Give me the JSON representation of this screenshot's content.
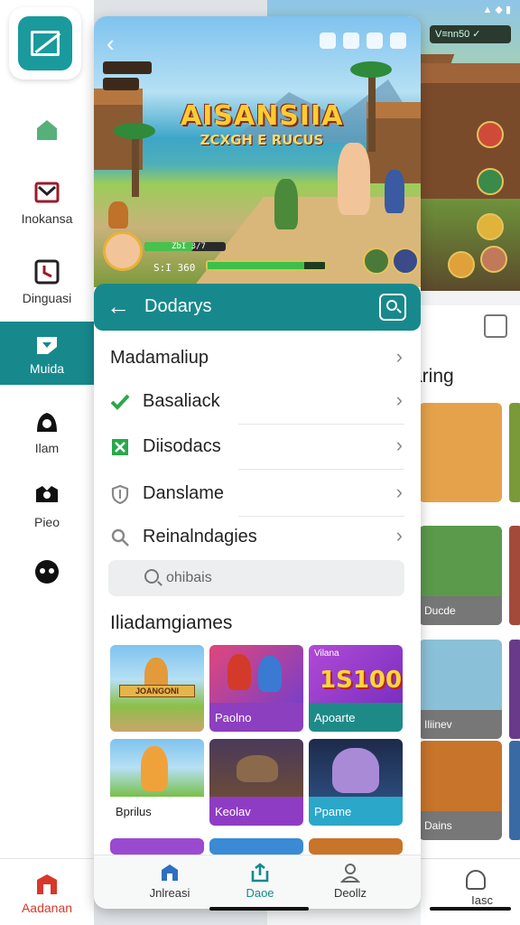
{
  "background_app": {
    "status": "▲ ◆ ▮",
    "hud_label": "V≡nn50 ✓",
    "section_title": "aring",
    "cards": [
      {
        "label": "",
        "color": "#e07b39"
      },
      {
        "label": "Ducde",
        "color": "#8c8f93"
      },
      {
        "label": "Iliinev",
        "color": "#8c8f93"
      },
      {
        "label": "Dains",
        "color": "#8c8f93"
      }
    ],
    "nav_label": "Iasc"
  },
  "sidebar": {
    "logo_icon": "presentation-logo-icon",
    "items": [
      {
        "icon": "home-icon",
        "label": ""
      },
      {
        "icon": "inbox-icon",
        "label": "Inokansa"
      },
      {
        "icon": "clock-icon",
        "label": "Dinguasi"
      },
      {
        "icon": "media-icon",
        "label": "Muida",
        "active": true
      },
      {
        "icon": "person-icon",
        "label": "Ilam"
      },
      {
        "icon": "gallery-icon",
        "label": "Pieo"
      },
      {
        "icon": "controller-icon",
        "label": ""
      }
    ],
    "bottom_label": "Aadanan",
    "accent": "#17898c"
  },
  "hero": {
    "game_title": "AISANSIIA",
    "game_subtitle": "ZCXGH E RUCUS",
    "score": "S:I 360",
    "hp_label": "ZbI 3/7"
  },
  "header": {
    "title": "Dodarys"
  },
  "menu": {
    "heading": "Madamaliup",
    "items": [
      {
        "icon": "check-icon",
        "label": "Basaliack"
      },
      {
        "icon": "close-box-icon",
        "label": "Diisodacs"
      },
      {
        "icon": "shield-icon",
        "label": "Danslame"
      },
      {
        "icon": "search-icon",
        "label": "Reinalndagies"
      }
    ]
  },
  "search": {
    "placeholder": "ohibais"
  },
  "games_section": {
    "title": "Iliadamgiames",
    "cards": [
      {
        "label": "",
        "banner": "JOANGONI",
        "color": "#e3d3b2",
        "cap_color": "#e7dcc7"
      },
      {
        "label": "Paolno",
        "color": "#c44ab8",
        "cap_color": "#8c3fbf"
      },
      {
        "label": "Apoarte",
        "big": "1S100",
        "tag": "Vilana",
        "color": "#9a3fc7",
        "cap_color": "#1e8a88"
      },
      {
        "label": "Bprilus",
        "color": "#5db6e8",
        "cap_color": "#8c8f93"
      },
      {
        "label": "Keolav",
        "color": "#6a4a3a",
        "cap_color": "#8f3cc4"
      },
      {
        "label": "Ppame",
        "color": "#1d2a4a",
        "cap_color": "#2ba7c9"
      }
    ]
  },
  "bottom_nav": {
    "items": [
      {
        "icon": "building-icon",
        "label": "Jnlreasi"
      },
      {
        "icon": "share-icon",
        "label": "Daoe",
        "active": true
      },
      {
        "icon": "user-icon",
        "label": "Deollz"
      }
    ]
  }
}
